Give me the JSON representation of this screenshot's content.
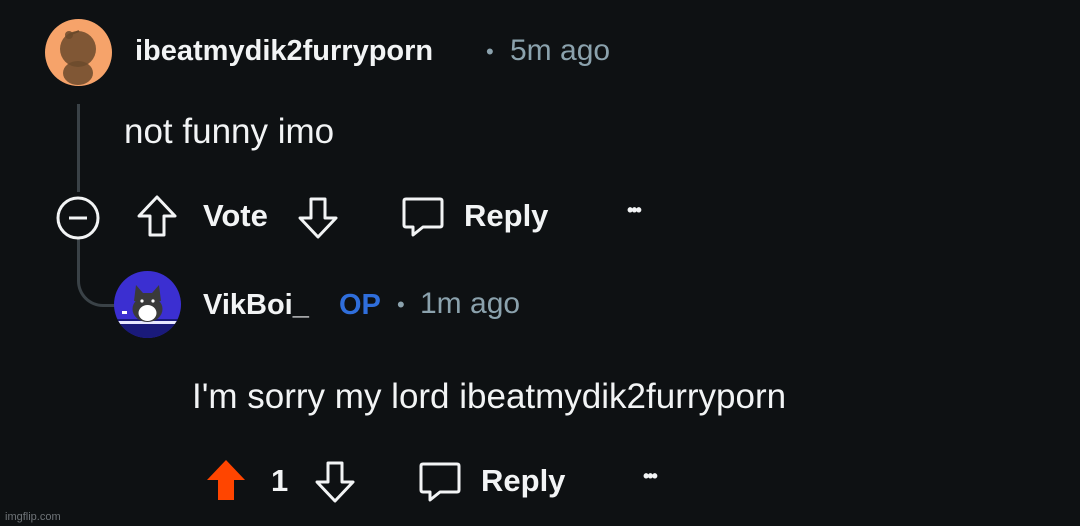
{
  "comments": [
    {
      "username": "ibeatmydik2furryporn",
      "time": "5m ago",
      "text": "not funny imo",
      "vote_label": "Vote",
      "reply_label": "Reply",
      "more": "•••",
      "avatar_color": "#f6a36a"
    },
    {
      "username": "VikBoi_",
      "badge": "OP",
      "time": "1m ago",
      "text": "I'm sorry my lord ibeatmydik2furryporn",
      "vote_count": "1",
      "reply_label": "Reply",
      "more": "•••",
      "avatar_color": "#3b2fd1",
      "upvote_color": "#ff4500"
    }
  ],
  "separator": "•",
  "watermark": "imgflip.com"
}
